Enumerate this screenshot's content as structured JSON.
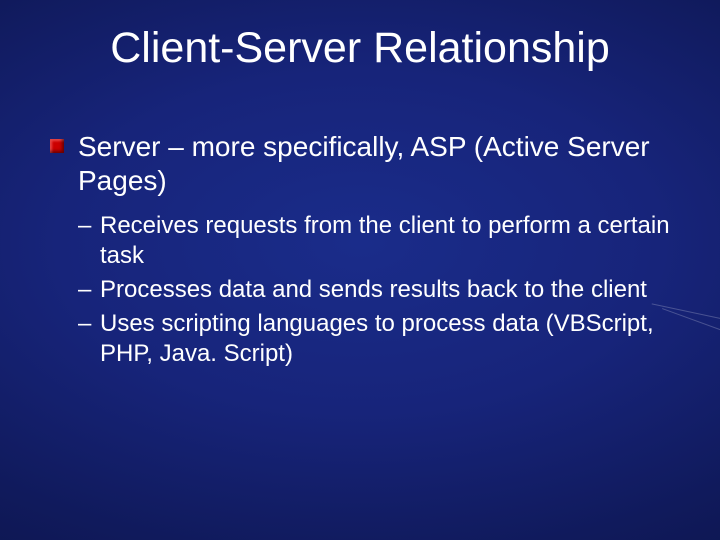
{
  "title": "Client-Server Relationship",
  "main_point": "Server – more specifically, ASP (Active Server Pages)",
  "sub_points": [
    "Receives requests from the client to perform a certain task",
    "Processes data and sends results back to the client",
    "Uses scripting languages to process data (VBScript, PHP, Java. Script)"
  ]
}
